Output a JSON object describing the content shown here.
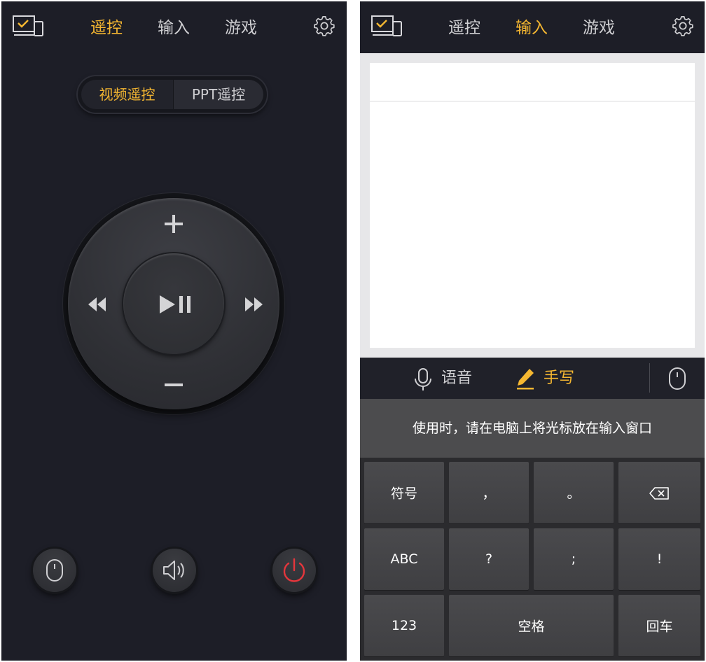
{
  "left_screen": {
    "tabs": [
      {
        "label": "遥控",
        "active": true
      },
      {
        "label": "输入",
        "active": false
      },
      {
        "label": "游戏",
        "active": false
      }
    ],
    "segment": {
      "options": [
        "视频遥控",
        "PPT遥控"
      ],
      "selected": "视频遥控"
    },
    "dial": {
      "up_icon": "plus-icon",
      "down_icon": "minus-icon",
      "left_icon": "rewind-icon",
      "right_icon": "fast-forward-icon",
      "center_icon": "play-pause-icon"
    },
    "bottom_buttons": [
      "mouse-icon",
      "speaker-icon",
      "power-icon"
    ]
  },
  "right_screen": {
    "tabs": [
      {
        "label": "遥控",
        "active": false
      },
      {
        "label": "输入",
        "active": true
      },
      {
        "label": "游戏",
        "active": false
      }
    ],
    "input_value": "",
    "modes": [
      {
        "label": "语音",
        "icon": "microphone-icon",
        "active": false
      },
      {
        "label": "手写",
        "icon": "pencil-icon",
        "active": true
      }
    ],
    "hint": "使用时，请在电脑上将光标放在输入窗口",
    "keys": [
      [
        "符号",
        "，",
        "。",
        "backspace-icon"
      ],
      [
        "ABC",
        "?",
        ";",
        "!"
      ],
      [
        "123",
        "空格",
        "回车"
      ]
    ]
  },
  "colors": {
    "background": "#1d1e27",
    "accent": "#f5b731",
    "text": "#d0d0d3",
    "power_red": "#e5363c"
  }
}
